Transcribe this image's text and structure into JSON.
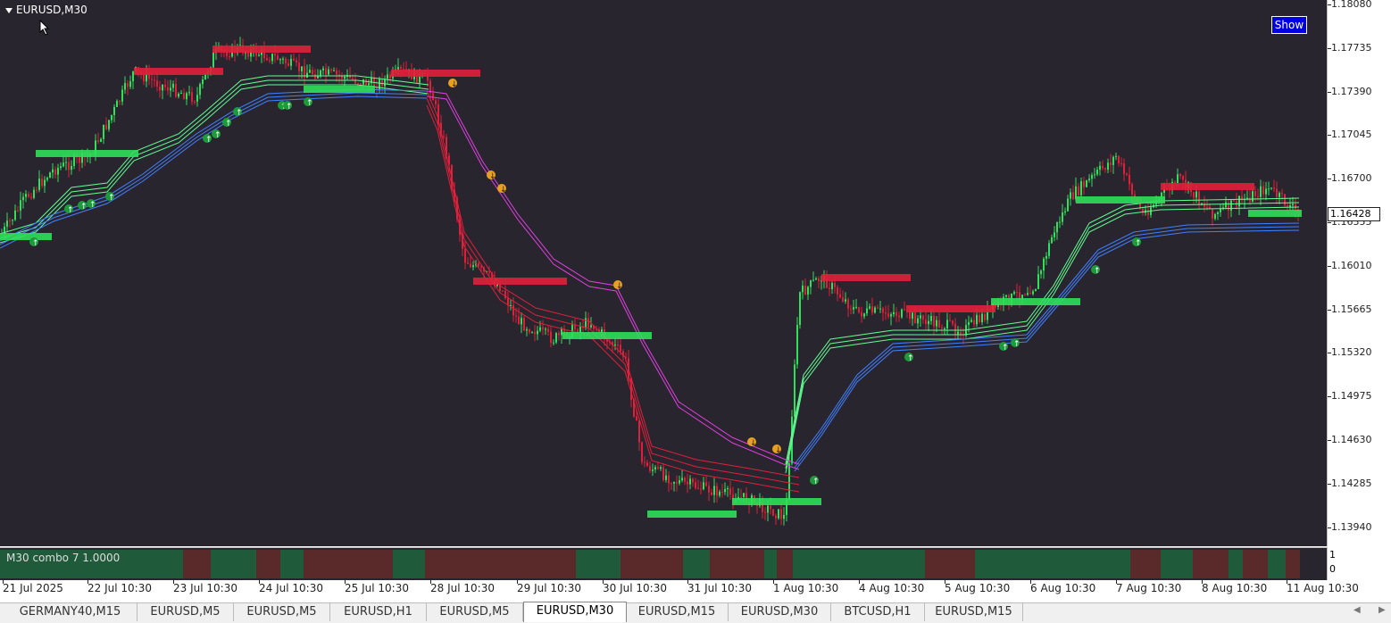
{
  "chart": {
    "symbol": "EURUSD,M30",
    "show_button": "Show",
    "current_price": "1.16428",
    "price_labels": [
      "1.18080",
      "1.17735",
      "1.17390",
      "1.17045",
      "1.16700",
      "1.16355",
      "1.16010",
      "1.15665",
      "1.15320",
      "1.14975",
      "1.14630",
      "1.14285",
      "1.13940"
    ],
    "time_labels": [
      "21 Jul 2025",
      "22 Jul 10:30",
      "23 Jul 10:30",
      "24 Jul 10:30",
      "25 Jul 10:30",
      "28 Jul 10:30",
      "29 Jul 10:30",
      "30 Jul 10:30",
      "31 Jul 10:30",
      "1 Aug 10:30",
      "4 Aug 10:30",
      "5 Aug 10:30",
      "6 Aug 10:30",
      "7 Aug 10:30",
      "8 Aug 10:30",
      "11 Aug 10:30"
    ],
    "colors": {
      "background": "#29252f",
      "bull": "#2ee05a",
      "bear": "#e0203a",
      "upper_band": "#e040e0",
      "lower_band": "#4080ff",
      "green_band": "#60ff90"
    }
  },
  "subwindow": {
    "label": "M30 combo 7  1.0000",
    "axis_labels": [
      "1",
      "0"
    ]
  },
  "tabs": [
    "GERMANY40,M15",
    "EURUSD,M5",
    "EURUSD,M5",
    "EURUSD,H1",
    "EURUSD,M5",
    "EURUSD,M30",
    "EURUSD,M15",
    "EURUSD,M30",
    "BTCUSD,H1",
    "EURUSD,M15"
  ],
  "active_tab_index": 5
}
